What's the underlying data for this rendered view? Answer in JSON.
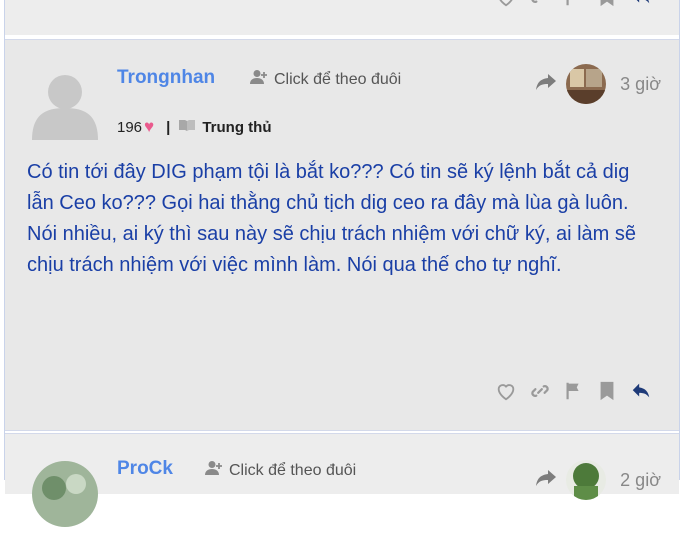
{
  "post": {
    "username": "Trongnhan",
    "follow_label": "Click để theo đuôi",
    "likes": "196",
    "rank": "Trung thủ",
    "time": "3 giờ",
    "body": "Có tin tới đây DIG phạm tội là bắt ko??? Có tin sẽ ký lệnh bắt cả dig lẫn Ceo ko??? Gọi hai thằng chủ tịch dig ceo ra đây mà lùa gà luôn. Nói nhiều, ai ký thì sau này sẽ chịu trách nhiệm với chữ ký, ai làm sẽ chịu trách nhiệm với việc mình làm. Nói qua thế cho tự nghĩ."
  },
  "next_post": {
    "username": "ProCk",
    "follow_label": "Click để theo đuôi",
    "time": "2 giờ"
  },
  "icons": [
    "heart-icon",
    "link-icon",
    "flag-icon",
    "bookmark-icon",
    "reply-icon",
    "add-user-icon",
    "share-arrow-icon",
    "book-icon"
  ],
  "colors": {
    "username": "#4f86e6",
    "body_text": "#1a3fa6",
    "heart": "#ea5a8d",
    "post_bg": "#e8e8e8"
  }
}
